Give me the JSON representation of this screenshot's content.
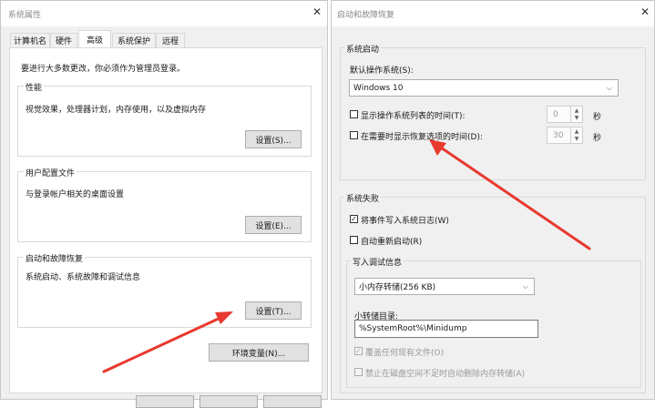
{
  "left_window": {
    "title": "系统属性",
    "close_glyph": "✕",
    "tabs": [
      {
        "label": "计算机名"
      },
      {
        "label": "硬件"
      },
      {
        "label": "高级"
      },
      {
        "label": "系统保护"
      },
      {
        "label": "远程"
      }
    ],
    "admin_note": "要进行大多数更改，你必须作为管理员登录。",
    "performance": {
      "heading": "性能",
      "description": "视觉效果，处理器计划，内存使用，以及虚拟内存",
      "button": "设置(S)..."
    },
    "user_profiles": {
      "heading": "用户配置文件",
      "description": "与登录帐户相关的桌面设置",
      "button": "设置(E)..."
    },
    "startup_recovery": {
      "heading": "启动和故障恢复",
      "description": "系统启动、系统故障和调试信息",
      "button": "设置(T)..."
    },
    "env_button": "环境变量(N)..."
  },
  "right_window": {
    "title": "启动和故障恢复",
    "close_glyph": "✕",
    "system_startup": {
      "heading": "系统启动",
      "default_os_label": "默认操作系统(S):",
      "default_os_value": "Windows 10",
      "show_list_label": "显示操作系统列表的时间(T):",
      "show_list_checked": false,
      "show_list_value": "0",
      "show_recovery_label": "在需要时显示恢复选项的时间(D):",
      "show_recovery_checked": false,
      "show_recovery_value": "30",
      "seconds_unit": "秒"
    },
    "system_failure": {
      "heading": "系统失败",
      "write_event_label": "将事件写入系统日志(W)",
      "write_event_checked": true,
      "auto_restart_label": "自动重新启动(R)",
      "auto_restart_checked": false,
      "debug_info": {
        "heading": "写入调试信息",
        "dump_type": "小内存转储(256 KB)",
        "dump_dir_label": "小转储目录:",
        "dump_dir_value": "%SystemRoot%\\Minidump",
        "overwrite_label": "覆盖任何现有文件(O)",
        "overwrite_checked": true,
        "disable_auto_delete_label": "禁止在磁盘空间不足时自动删除内存转储(A)",
        "disable_auto_delete_checked": false
      }
    }
  },
  "colors": {
    "arrow": "#e8392f",
    "dialog_bg": "#f0f0f0",
    "panel_bg": "#ffffff"
  }
}
